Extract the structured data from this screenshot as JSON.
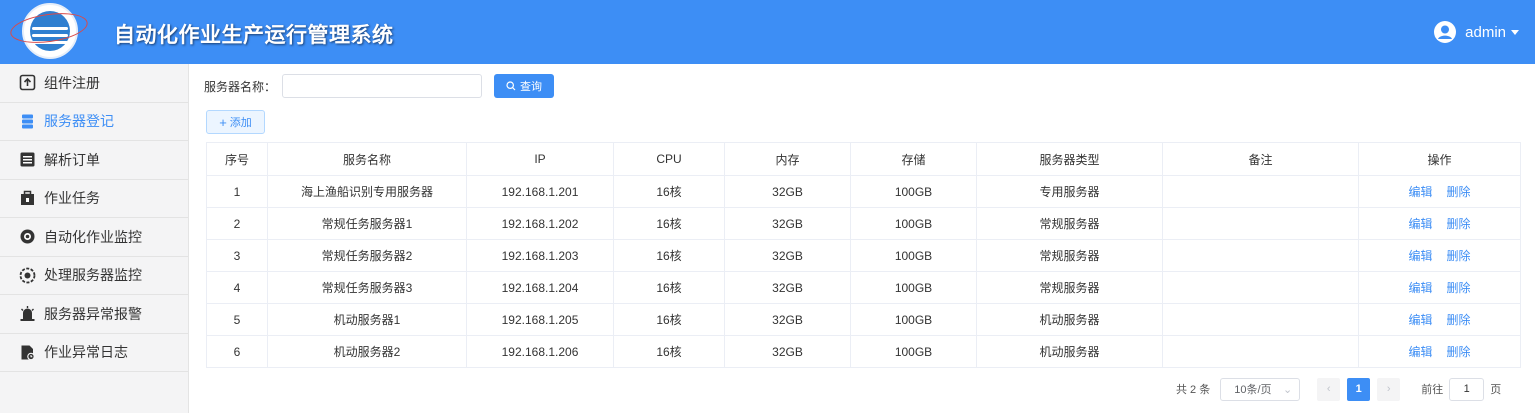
{
  "header": {
    "app_title": "自动化作业生产运行管理系统",
    "user_name": "admin"
  },
  "sidebar": {
    "items": [
      {
        "label": "组件注册",
        "icon": "upload-icon",
        "active": false
      },
      {
        "label": "服务器登记",
        "icon": "server-icon",
        "active": true
      },
      {
        "label": "解析订单",
        "icon": "list-icon",
        "active": false
      },
      {
        "label": "作业任务",
        "icon": "briefcase-icon",
        "active": false
      },
      {
        "label": "自动化作业监控",
        "icon": "target-icon",
        "active": false
      },
      {
        "label": "处理服务器监控",
        "icon": "gear-icon",
        "active": false
      },
      {
        "label": "服务器异常报警",
        "icon": "alarm-icon",
        "active": false
      },
      {
        "label": "作业异常日志",
        "icon": "log-icon",
        "active": false
      }
    ]
  },
  "filter": {
    "label": "服务器名称：",
    "input_value": "",
    "query_label": "查询",
    "add_label": "添加"
  },
  "table": {
    "columns": [
      "序号",
      "服务名称",
      "IP",
      "CPU",
      "内存",
      "存储",
      "服务器类型",
      "备注",
      "操作"
    ],
    "rows": [
      [
        "1",
        "海上渔船识别专用服务器",
        "192.168.1.201",
        "16核",
        "32GB",
        "100GB",
        "专用服务器",
        ""
      ],
      [
        "2",
        "常规任务服务器1",
        "192.168.1.202",
        "16核",
        "32GB",
        "100GB",
        "常规服务器",
        ""
      ],
      [
        "3",
        "常规任务服务器2",
        "192.168.1.203",
        "16核",
        "32GB",
        "100GB",
        "常规服务器",
        ""
      ],
      [
        "4",
        "常规任务服务器3",
        "192.168.1.204",
        "16核",
        "32GB",
        "100GB",
        "常规服务器",
        ""
      ],
      [
        "5",
        "机动服务器1",
        "192.168.1.205",
        "16核",
        "32GB",
        "100GB",
        "机动服务器",
        ""
      ],
      [
        "6",
        "机动服务器2",
        "192.168.1.206",
        "16核",
        "32GB",
        "100GB",
        "机动服务器",
        ""
      ]
    ],
    "action_edit": "编辑",
    "action_delete": "删除"
  },
  "pagination": {
    "total": "共 2 条",
    "page_size": "10条/页",
    "current_page": "1",
    "goto_label": "前往",
    "goto_value": "1",
    "goto_suffix": "页"
  },
  "colors": {
    "accent": "#3d8ef5",
    "sidebar_bg": "#f4f4f5"
  }
}
